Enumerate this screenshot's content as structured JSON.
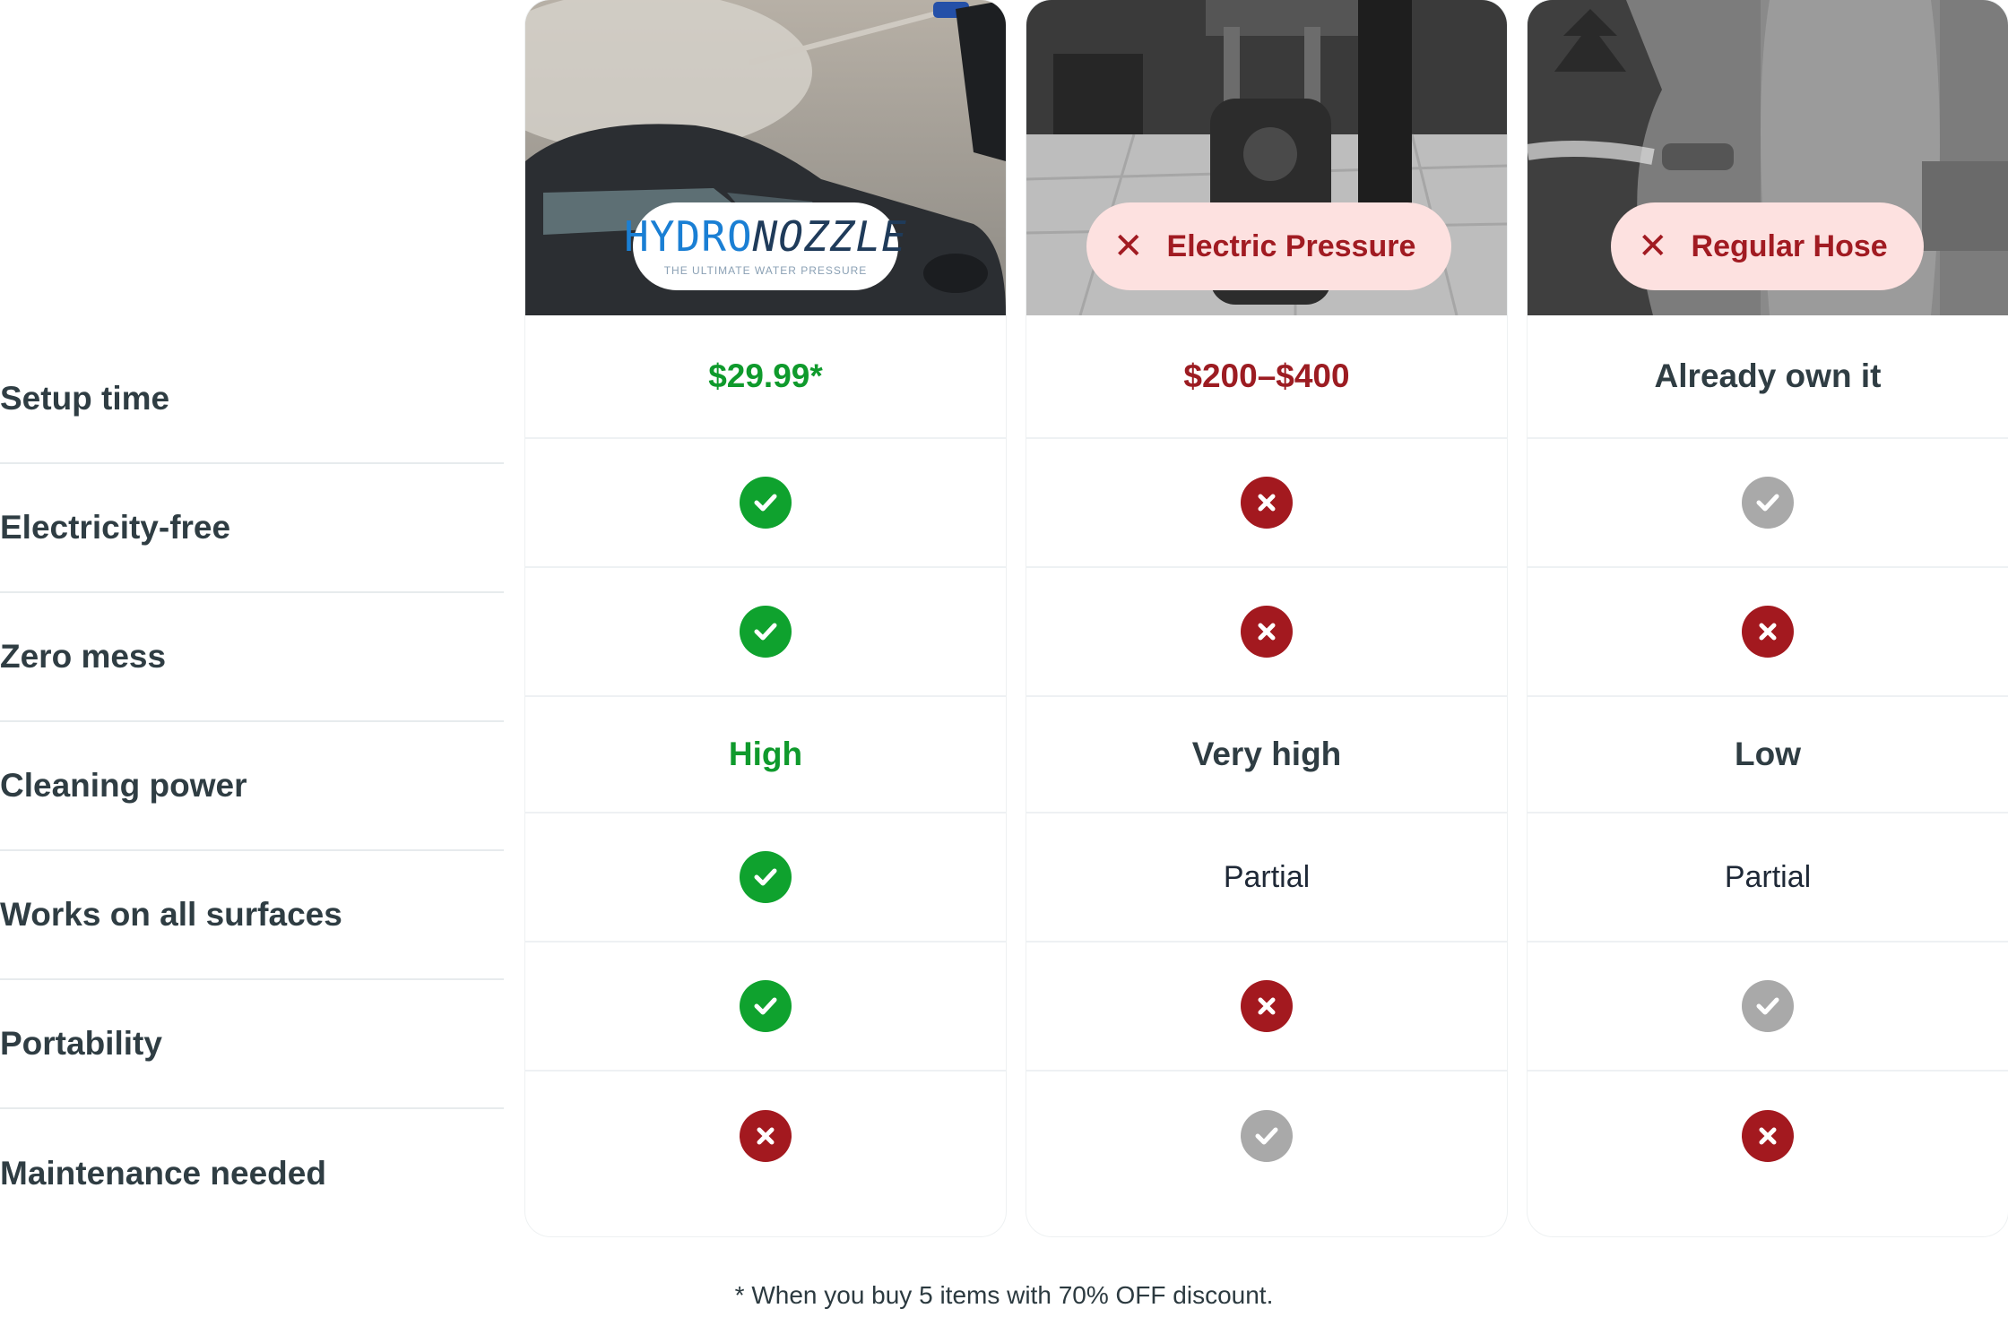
{
  "rows": [
    {
      "label": "Setup time"
    },
    {
      "label": "Electricity-free"
    },
    {
      "label": "Zero mess"
    },
    {
      "label": "Cleaning power"
    },
    {
      "label": "Works on all surfaces"
    },
    {
      "label": "Portability"
    },
    {
      "label": "Maintenance needed"
    }
  ],
  "columns": [
    {
      "name": "HydroNozzle",
      "badge_brand_1": "HYDRO",
      "badge_brand_2": "NOZZLE",
      "badge_tagline": "THE ULTIMATE WATER PRESSURE",
      "cells": [
        {
          "type": "text",
          "value": "$29.99*",
          "style": "green"
        },
        {
          "type": "icon",
          "value": "check-icon",
          "style": "ok"
        },
        {
          "type": "icon",
          "value": "check-icon",
          "style": "ok"
        },
        {
          "type": "text",
          "value": "High",
          "style": "green"
        },
        {
          "type": "icon",
          "value": "check-icon",
          "style": "ok"
        },
        {
          "type": "icon",
          "value": "check-icon",
          "style": "ok"
        },
        {
          "type": "icon",
          "value": "x-icon",
          "style": "no"
        }
      ]
    },
    {
      "name": "Electric Pressure",
      "badge_label": "Electric Pressure",
      "cells": [
        {
          "type": "text",
          "value": "$200–$400",
          "style": "red"
        },
        {
          "type": "icon",
          "value": "x-icon",
          "style": "no"
        },
        {
          "type": "icon",
          "value": "x-icon",
          "style": "no"
        },
        {
          "type": "text",
          "value": "Very high",
          "style": "dark"
        },
        {
          "type": "text",
          "value": "Partial",
          "style": "plain"
        },
        {
          "type": "icon",
          "value": "x-icon",
          "style": "no"
        },
        {
          "type": "icon",
          "value": "check-icon",
          "style": "na"
        }
      ]
    },
    {
      "name": "Regular Hose",
      "badge_label": "Regular Hose",
      "cells": [
        {
          "type": "text",
          "value": "Already own it",
          "style": "dark"
        },
        {
          "type": "icon",
          "value": "check-icon",
          "style": "na"
        },
        {
          "type": "icon",
          "value": "x-icon",
          "style": "no"
        },
        {
          "type": "text",
          "value": "Low",
          "style": "dark"
        },
        {
          "type": "text",
          "value": "Partial",
          "style": "plain"
        },
        {
          "type": "icon",
          "value": "check-icon",
          "style": "na"
        },
        {
          "type": "icon",
          "value": "x-icon",
          "style": "no"
        }
      ]
    }
  ],
  "footnote": "* When you buy 5 items with 70% OFF discount.",
  "colors": {
    "green": "#0fa22e",
    "red": "#a3191f",
    "gray": "#a9a9a9",
    "badge_pink": "#fde1e0"
  }
}
